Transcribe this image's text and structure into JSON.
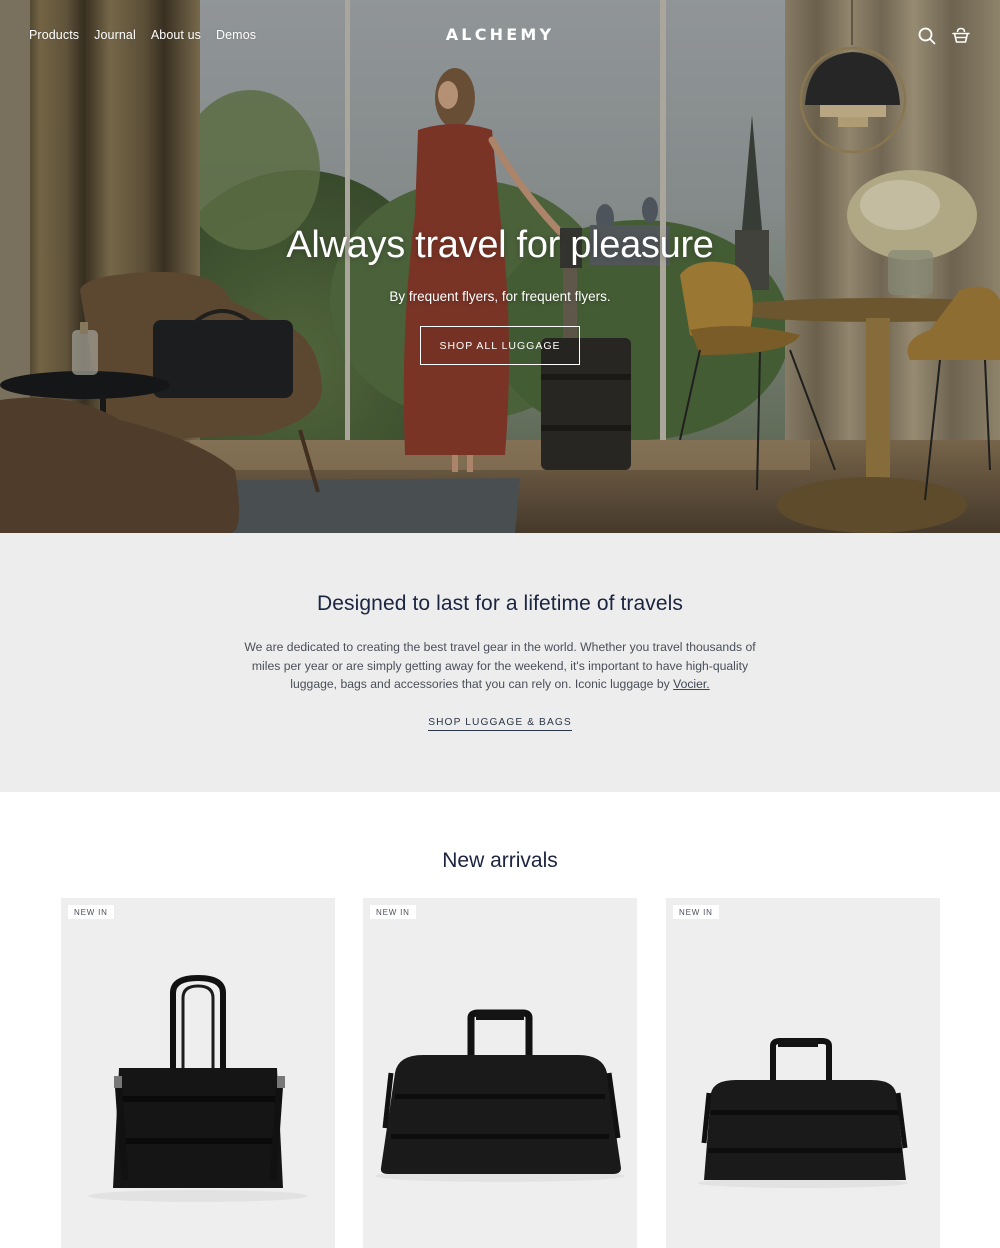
{
  "header": {
    "nav": [
      {
        "label": "Products"
      },
      {
        "label": "Journal"
      },
      {
        "label": "About us"
      },
      {
        "label": "Demos"
      }
    ],
    "logo": "ALCHEMY",
    "icons": [
      "search-icon",
      "cart-basket-icon"
    ]
  },
  "hero": {
    "title": "Always travel for pleasure",
    "subtitle": "By frequent flyers, for frequent flyers.",
    "button_label": "SHOP ALL LUGGAGE"
  },
  "intro": {
    "heading": "Designed to last for a lifetime of travels",
    "body": "We are dedicated to creating the best travel gear in the world. Whether you travel thousands of miles per year or are simply getting away for the weekend, it's important to have high-quality luggage, bags and accessories that you can rely on. Iconic luggage by ",
    "body_link": "Vocier.",
    "link_label": "SHOP LUGGAGE & BAGS"
  },
  "arrivals": {
    "heading": "New arrivals",
    "products": [
      {
        "badge": "NEW IN",
        "image": "black-tote-bag"
      },
      {
        "badge": "NEW IN",
        "image": "black-weekender-duffel-large"
      },
      {
        "badge": "NEW IN",
        "image": "black-weekender-duffel-small"
      }
    ]
  },
  "colors": {
    "heading_text": "#1b2440",
    "intro_bg": "#ededed",
    "card_bg": "#eeeeee"
  }
}
